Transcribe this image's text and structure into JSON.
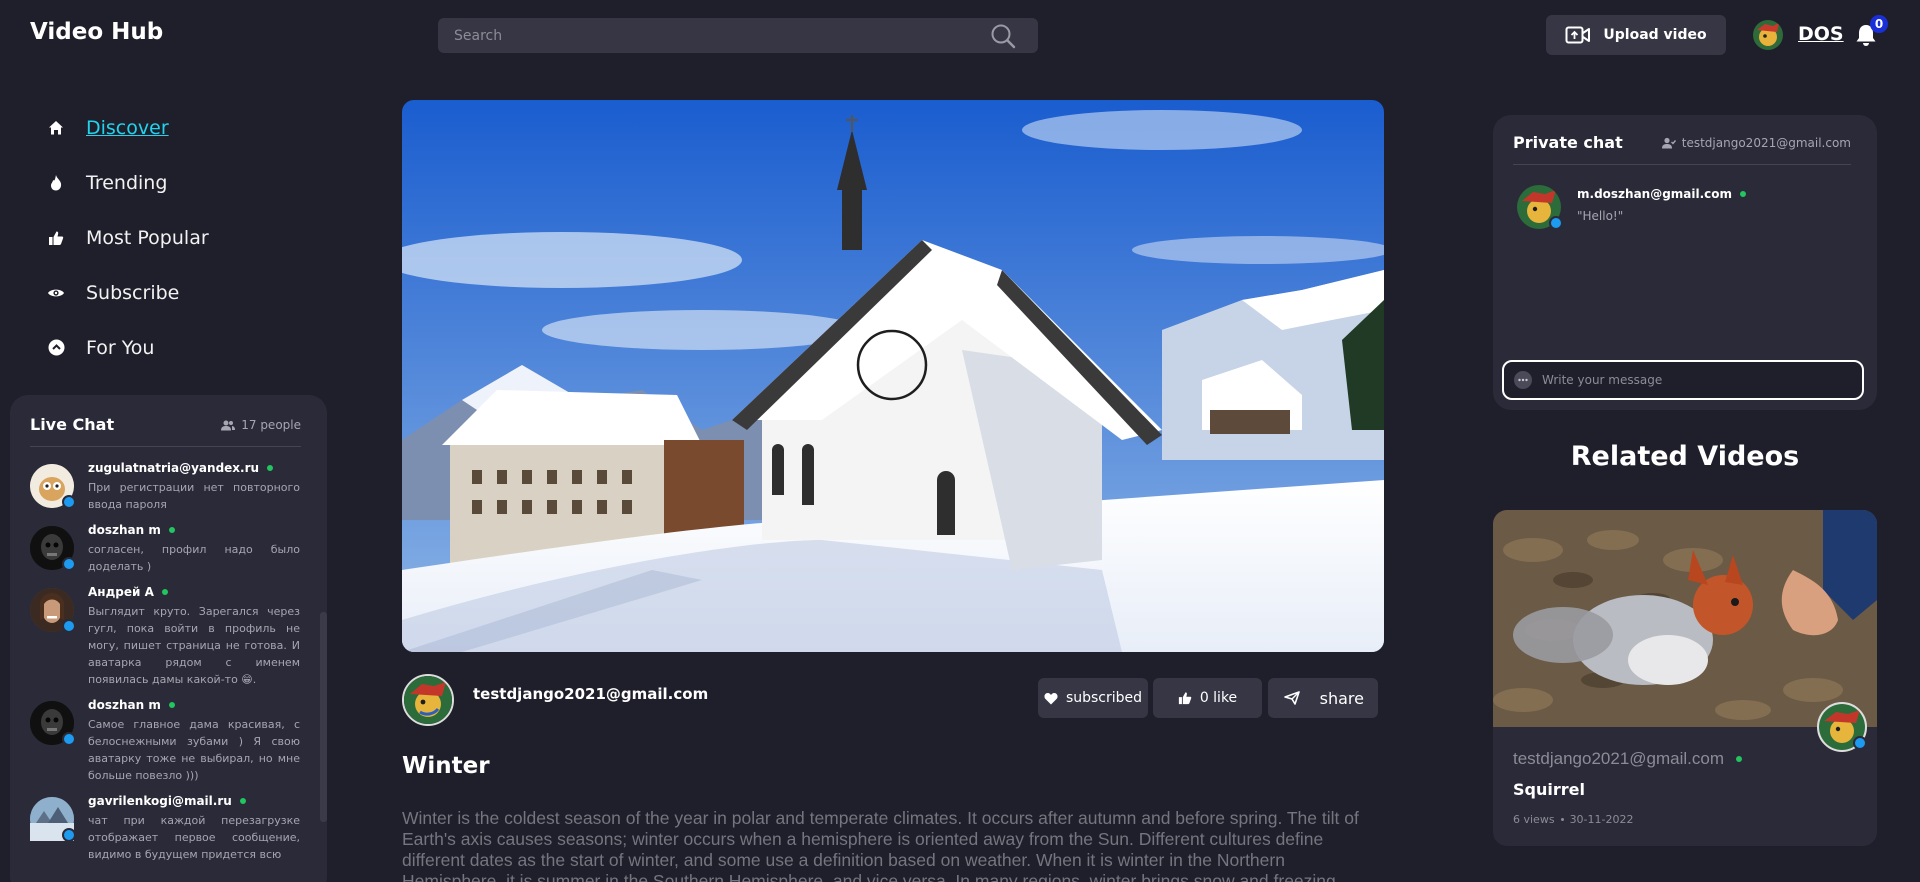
{
  "header": {
    "logo": "Video Hub",
    "search_placeholder": "Search",
    "upload_label": "Upload video",
    "username": "DOS",
    "notification_count": "0"
  },
  "nav": {
    "items": [
      {
        "label": "Discover",
        "icon": "home-icon",
        "active": true
      },
      {
        "label": "Trending",
        "icon": "fire-icon"
      },
      {
        "label": "Most Popular",
        "icon": "thumbs-up-icon"
      },
      {
        "label": "Subscribe",
        "icon": "eye-icon"
      },
      {
        "label": "For You",
        "icon": "chevron-up-circle-icon"
      }
    ]
  },
  "live_chat": {
    "title": "Live Chat",
    "people": "17 people",
    "messages": [
      {
        "name": "zugulatnatria@yandex.ru",
        "text": "При регистрации нет повторного ввода пароля"
      },
      {
        "name": "doszhan m",
        "text": "согласен, профил надо было доделать )"
      },
      {
        "name": "Андрей А",
        "text": "Выглядит круто. Зарегался через гугл, пока войти в профиль не могу, пишет страница не готова. И аватарка рядом с именем появилась дамы какой-то 😁."
      },
      {
        "name": "doszhan m",
        "text": "Самое главное дама красивая, с белоснежными зубами ) Я свою аватарку тоже не выбирал, но мне больше повезло )))"
      },
      {
        "name": "gavrilenkogi@mail.ru",
        "text": "чат при каждой перезагрузке отображает первое сообщение, видимо в будущем придется всю"
      }
    ]
  },
  "video": {
    "channel": "testdjango2021@gmail.com",
    "subscribed_label": "subscribed",
    "like_label": "0 like",
    "share_label": "share",
    "title": "Winter",
    "description": "Winter is the coldest season of the year in polar and temperate climates. It occurs after autumn and before spring. The tilt of Earth's axis causes seasons; winter occurs when a hemisphere is oriented away from the Sun. Different cultures define different dates as the start of winter, and some use a definition based on weather. When it is winter in the Northern Hemisphere, it is summer in the Southern Hemisphere, and vice versa. In many regions, winter brings snow and freezing"
  },
  "private_chat": {
    "title": "Private chat",
    "user": "testdjango2021@gmail.com",
    "message_name": "m.doszhan@gmail.com",
    "message_text": "\"Hello!\"",
    "input_placeholder": "Write your message"
  },
  "related": {
    "title": "Related Videos",
    "channel": "testdjango2021@gmail.com",
    "name": "Squirrel",
    "views": "6 views",
    "date": "30-11-2022"
  },
  "colors": {
    "background": "#1f1f2b",
    "panel": "#2a2a38",
    "accent": "#22d3ee",
    "online": "#22c55e",
    "verified": "#1d9bf0"
  }
}
